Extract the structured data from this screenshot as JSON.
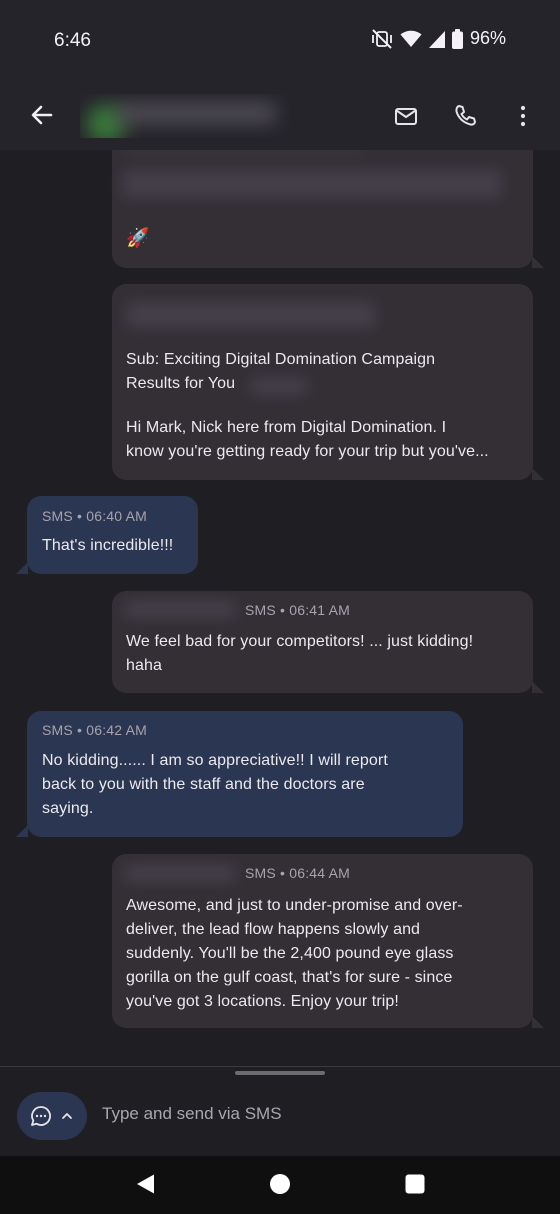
{
  "status": {
    "time": "6:46",
    "battery": "96%"
  },
  "icons": {
    "back": "arrow-left-icon",
    "email": "mail-icon",
    "phone": "phone-icon",
    "more": "more-vert-icon",
    "compose": "chat-bubble-icon",
    "expand": "chevron-up-icon",
    "rocket": "rocket-icon"
  },
  "messages": {
    "m1": {
      "emoji": "🚀"
    },
    "m2": {
      "line1": "Sub: Exciting Digital Domination Campaign",
      "line2": "Results for You",
      "line3": "Hi Mark, Nick here from Digital Domination. I",
      "line4": "know you're getting ready for your trip but you've..."
    },
    "m3": {
      "meta": "SMS • 06:40 AM",
      "line1": "That's incredible!!!"
    },
    "m4": {
      "meta": "SMS • 06:41 AM",
      "line1": "We feel bad for your competitors! ... just kidding!",
      "line2": "haha"
    },
    "m5": {
      "meta": "SMS • 06:42 AM",
      "line1": "No kidding...... I am so appreciative!! I will report",
      "line2": "back to you with the staff and the doctors are",
      "line3": "saying."
    },
    "m6": {
      "meta": "SMS • 06:44 AM",
      "line1": "Awesome, and just to under-promise and over-",
      "line2": "deliver, the lead flow happens slowly and",
      "line3": "suddenly. You'll be the 2,400 pound eye glass",
      "line4": "gorilla on the gulf coast, that's for sure - since",
      "line5": "you've got 3 locations. Enjoy your trip!"
    }
  },
  "compose": {
    "placeholder": "Type and send via SMS"
  },
  "colors": {
    "outgoing_bubble": "#342e35",
    "incoming_bubble": "#2b3652",
    "background": "#1f1e23"
  }
}
